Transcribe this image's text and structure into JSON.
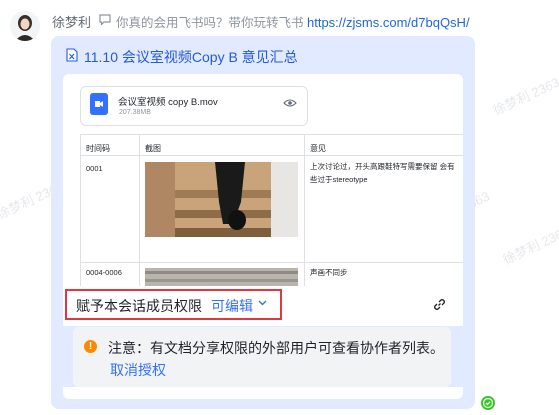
{
  "message": {
    "sender": "徐梦利",
    "reply_quote": "你真的会用飞书吗？带你玩转飞书",
    "reply_link": "https://zjsms.com/d7bqQsH/"
  },
  "card": {
    "title": "11.10 会议室视频Copy B 意见汇总",
    "file": {
      "name": "会议室视频 copy B.mov",
      "size": "207.38MB"
    },
    "table": {
      "headers": [
        "时间码",
        "截图",
        "意见"
      ],
      "rows": [
        {
          "timecode": "0001",
          "comment": "上次讨论过，开头高跟鞋特写需要保留 会有些过于stereotype"
        },
        {
          "timecode": "0004-0006",
          "comment": "声画不同步"
        }
      ]
    },
    "permission": {
      "label": "赋予本会话成员权限",
      "value": "可编辑"
    },
    "notice": {
      "text": "注意：有文档分享权限的外部用户可查看协作者列表。",
      "action": "取消授权"
    }
  },
  "watermark": "徐梦利 2363",
  "colors": {
    "link": "#3370ff",
    "highlight": "#e0383e",
    "card_bg": "#e1eaff",
    "warning": "#ff8800"
  }
}
